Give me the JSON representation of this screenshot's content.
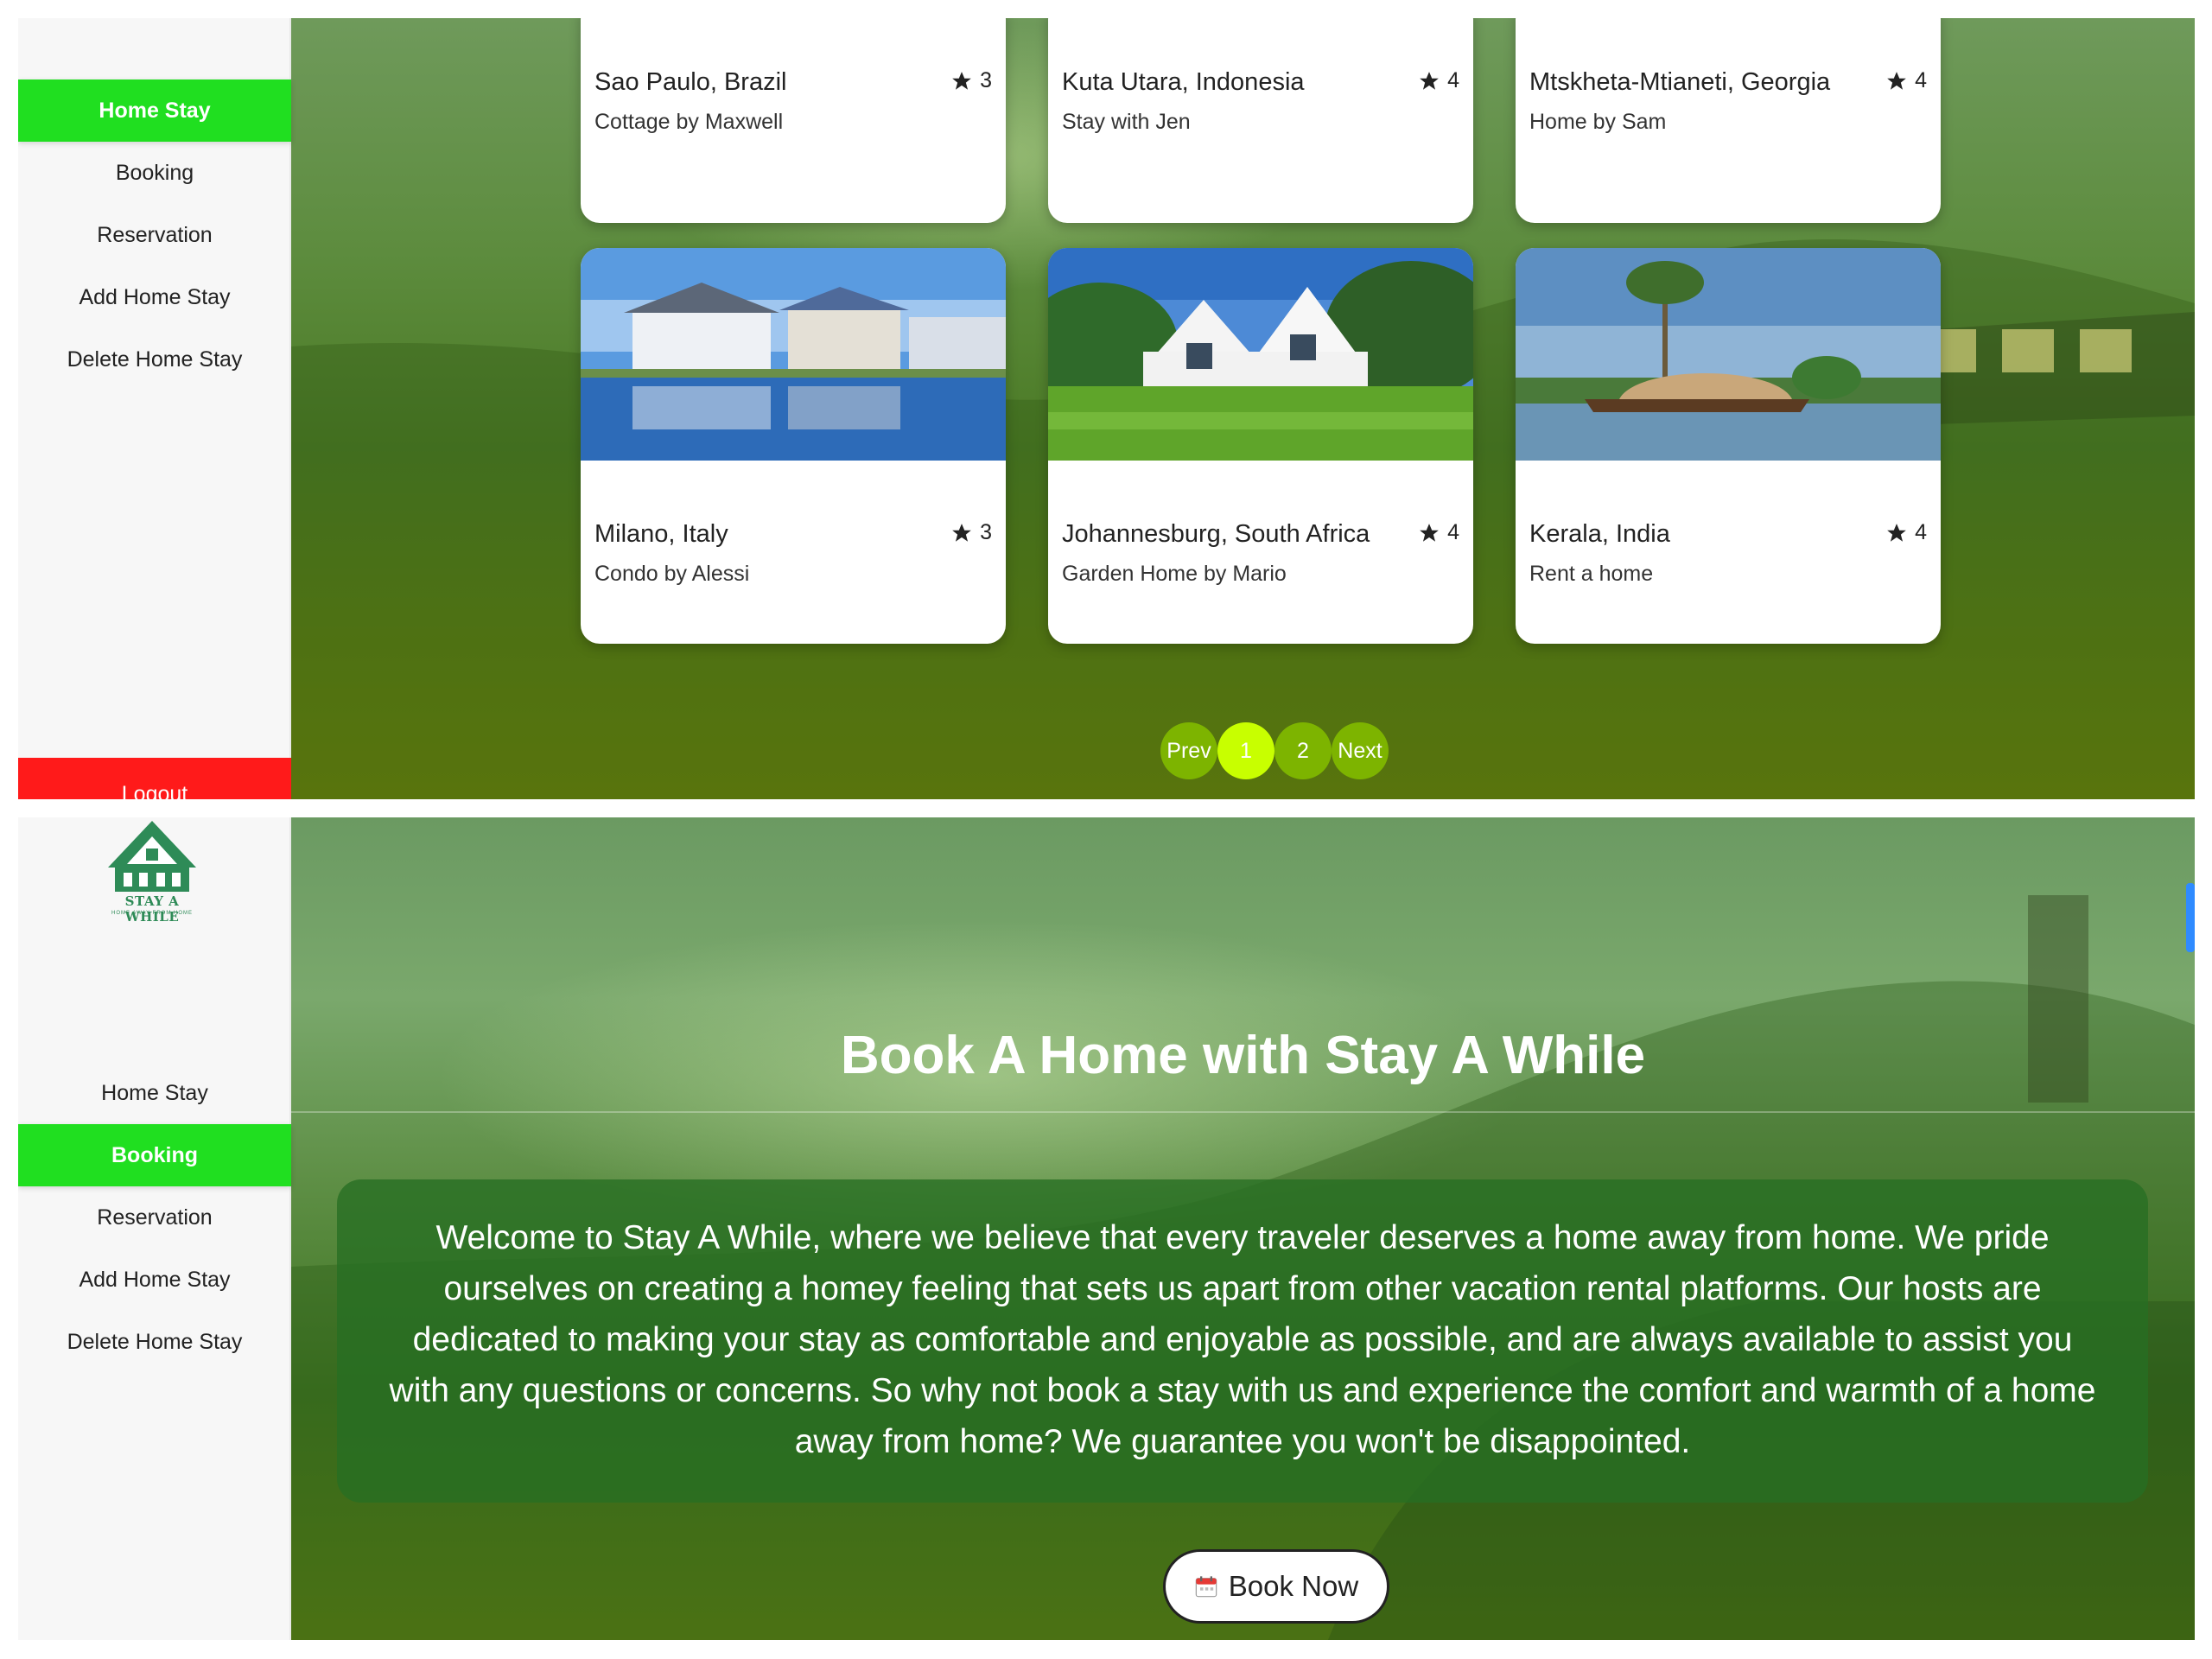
{
  "top_panel": {
    "sidebar": {
      "items": [
        {
          "label": "Home Stay",
          "active": true
        },
        {
          "label": "Booking",
          "active": false
        },
        {
          "label": "Reservation",
          "active": false
        },
        {
          "label": "Add Home Stay",
          "active": false
        },
        {
          "label": "Delete Home Stay",
          "active": false
        }
      ],
      "logout_label": "Logout"
    },
    "cards": [
      {
        "place": "Sao Paulo, Brazil",
        "subtitle": "Cottage by Maxwell",
        "rating": "3"
      },
      {
        "place": "Kuta Utara, Indonesia",
        "subtitle": "Stay with Jen",
        "rating": "4"
      },
      {
        "place": "Mtskheta-Mtianeti, Georgia",
        "subtitle": "Home by Sam",
        "rating": "4"
      },
      {
        "place": "Milano, Italy",
        "subtitle": "Condo by Alessi",
        "rating": "3"
      },
      {
        "place": "Johannesburg, South Africa",
        "subtitle": "Garden Home by Mario",
        "rating": "4"
      },
      {
        "place": "Kerala, India",
        "subtitle": "Rent a home",
        "rating": "4"
      }
    ],
    "pagination": {
      "prev": "Prev",
      "pages": [
        "1",
        "2"
      ],
      "current": "1",
      "next": "Next"
    }
  },
  "bottom_panel": {
    "logo": {
      "name": "STAY A WHILE",
      "tagline": "HOME AWAY FROM HOME"
    },
    "sidebar": {
      "items": [
        {
          "label": "Home Stay",
          "active": false
        },
        {
          "label": "Booking",
          "active": true
        },
        {
          "label": "Reservation",
          "active": false
        },
        {
          "label": "Add Home Stay",
          "active": false
        },
        {
          "label": "Delete Home Stay",
          "active": false
        }
      ]
    },
    "hero_title": "Book A Home with Stay A While",
    "welcome_text": "Welcome to Stay A While, where we believe that every traveler deserves a home away from home. We pride ourselves on creating a homey feeling that sets us apart from other vacation rental platforms. Our hosts are dedicated to making your stay as comfortable and enjoyable as possible, and are always available to assist you with any questions or concerns. So why not book a stay with us and experience the comfort and warmth of a home away from home? We guarantee you won't be disappointed.",
    "book_button": "Book Now"
  },
  "colors": {
    "active_nav": "#20df20",
    "logout": "#ff1a1a",
    "pager": "#7db400",
    "pager_active": "#c8ff00",
    "brand": "#2e8b57"
  }
}
